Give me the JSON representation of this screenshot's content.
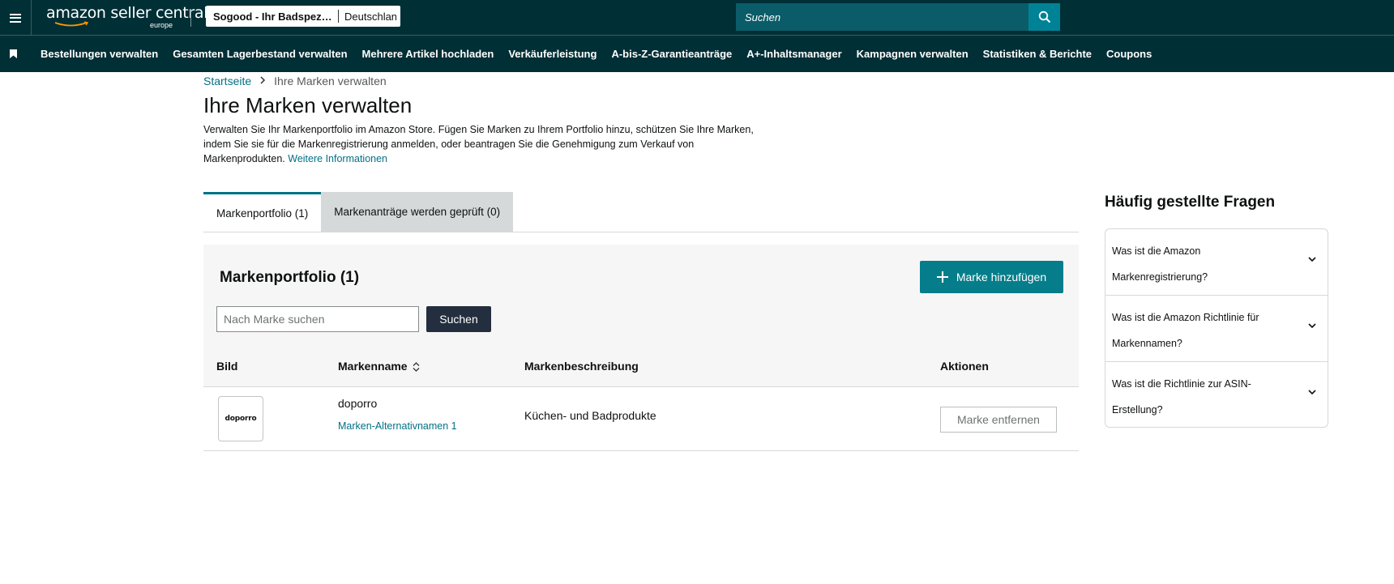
{
  "topbar": {
    "logo_main": "amazon seller central",
    "logo_sub": "europe",
    "account_name": "Sogood - Ihr Badspezialist",
    "account_market": "Deutschland",
    "search_placeholder": "Suchen"
  },
  "nav": {
    "items": [
      "Bestellungen verwalten",
      "Gesamten Lagerbestand verwalten",
      "Mehrere Artikel hochladen",
      "Verkäuferleistung",
      "A-bis-Z-Garantieanträge",
      "A+-Inhaltsmanager",
      "Kampagnen verwalten",
      "Statistiken & Berichte",
      "Coupons"
    ]
  },
  "breadcrumb": {
    "home": "Startseite",
    "current": "Ihre Marken verwalten"
  },
  "page": {
    "title": "Ihre Marken verwalten",
    "description": "Verwalten Sie Ihr Markenportfolio im Amazon Store. Fügen Sie Marken zu Ihrem Portfolio hinzu, schützen Sie Ihre Marken, indem Sie sie für die Markenregistrierung anmelden, oder beantragen Sie die Genehmigung zum Verkauf von Markenprodukten.",
    "more_link": "Weitere Informationen"
  },
  "tabs": [
    {
      "label": "Markenportfolio (1)",
      "active": true
    },
    {
      "label": "Markenanträge werden geprüft (0)",
      "active": false
    }
  ],
  "portfolio": {
    "title": "Markenportfolio (1)",
    "add_button": "Marke hinzufügen",
    "search_placeholder": "Nach Marke suchen",
    "search_button": "Suchen",
    "columns": {
      "image": "Bild",
      "name": "Markenname",
      "description": "Markenbeschreibung",
      "actions": "Aktionen"
    },
    "rows": [
      {
        "logo_text": "doporro",
        "name": "doporro",
        "alt_names": "Marken-Alternativnamen 1",
        "description": "Küchen- und Badprodukte",
        "action": "Marke entfernen"
      }
    ]
  },
  "faq": {
    "title": "Häufig gestellte Fragen",
    "items": [
      "Was ist die Amazon Markenregistrierung?",
      "Was ist die Amazon Richtlinie für Markennamen?",
      "Was ist die Richtlinie zur ASIN-Erstellung?"
    ]
  },
  "colors": {
    "header_bg": "#002f36",
    "search_bg": "#0a5c68",
    "accent": "#007185",
    "add_button": "#067d8a",
    "dark_button": "#232f3e"
  },
  "icons": [
    "menu-icon",
    "search-icon",
    "bookmark-icon",
    "chevron-right-icon",
    "sort-icon",
    "plus-icon",
    "chevron-down-icon"
  ]
}
